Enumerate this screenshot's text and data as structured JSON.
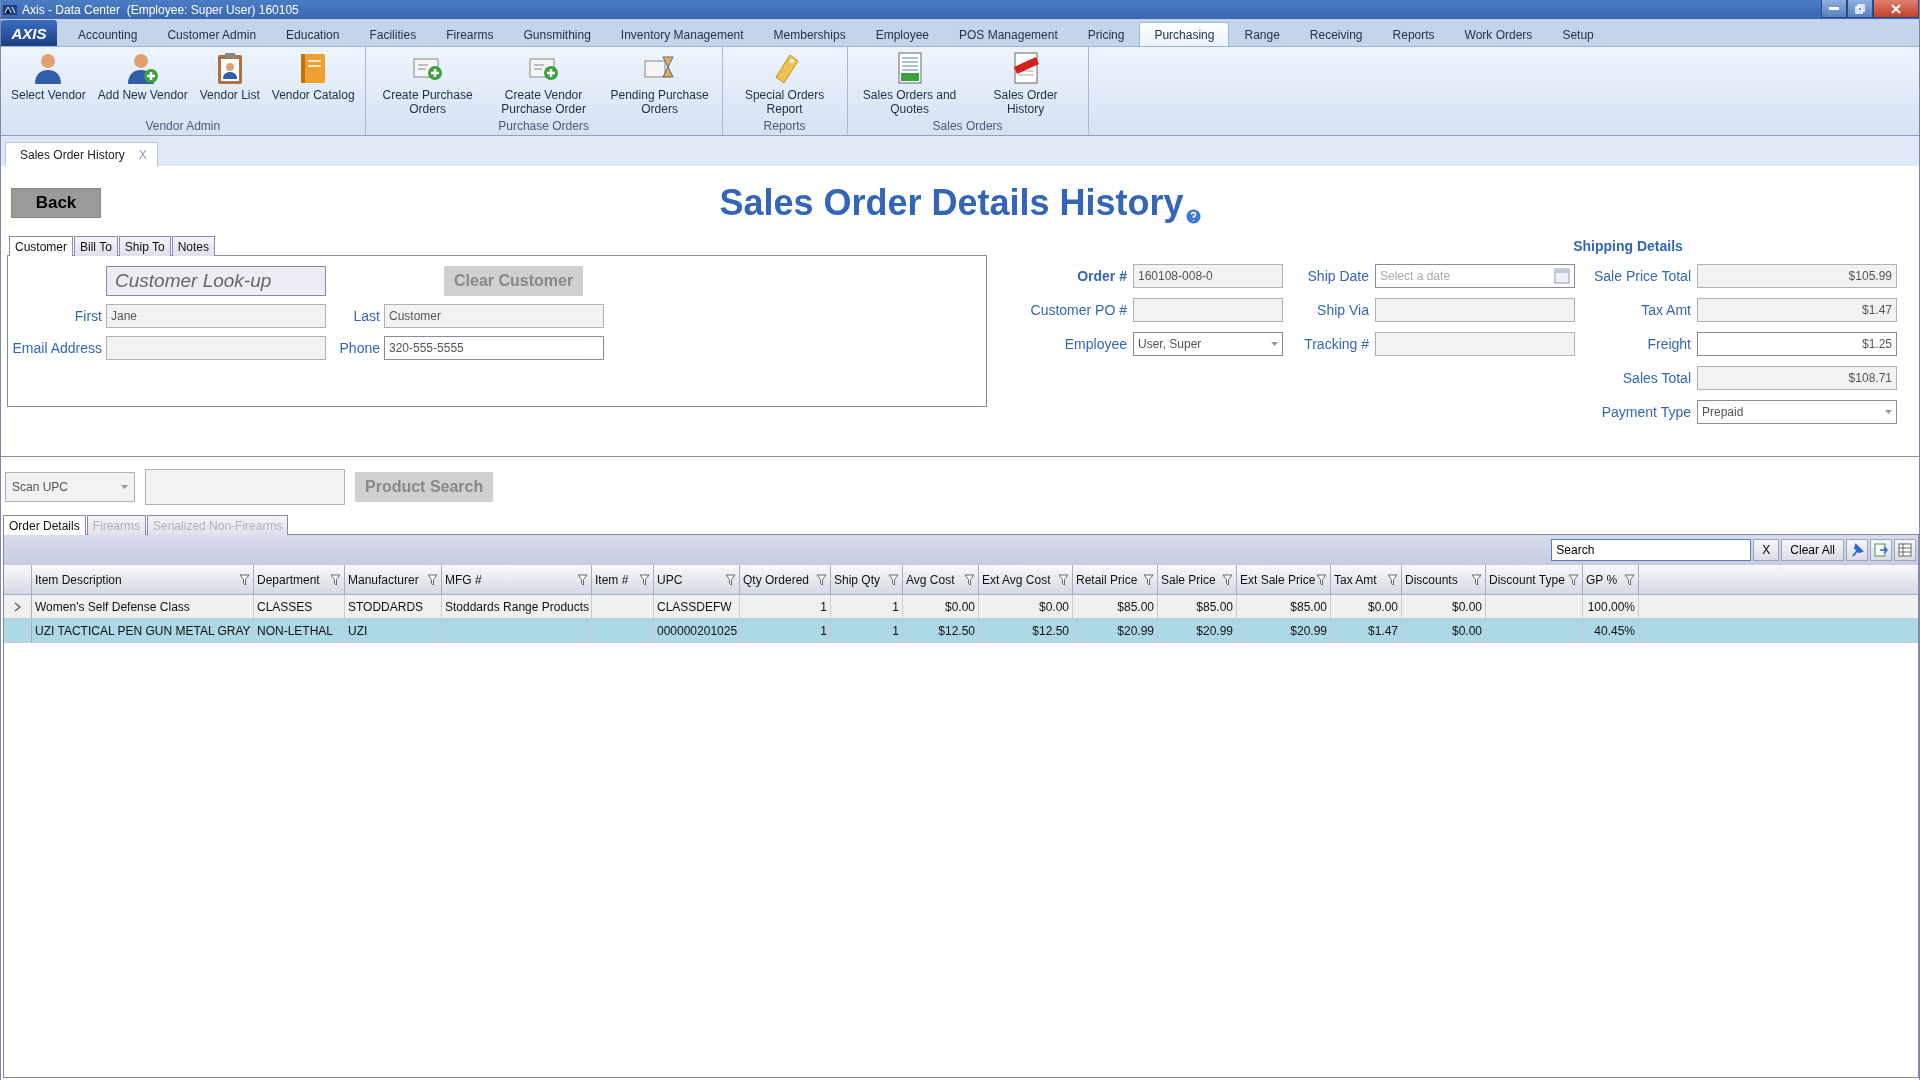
{
  "window": {
    "title": "Axis - Data Center  (Employee: Super User) 160105"
  },
  "app_button": {
    "label": "AXIS"
  },
  "menu_tabs": [
    {
      "label": "Accounting",
      "selected": false
    },
    {
      "label": "Customer Admin",
      "selected": false
    },
    {
      "label": "Education",
      "selected": false
    },
    {
      "label": "Facilities",
      "selected": false
    },
    {
      "label": "Firearms",
      "selected": false
    },
    {
      "label": "Gunsmithing",
      "selected": false
    },
    {
      "label": "Inventory Management",
      "selected": false
    },
    {
      "label": "Memberships",
      "selected": false
    },
    {
      "label": "Employee",
      "selected": false
    },
    {
      "label": "POS Management",
      "selected": false
    },
    {
      "label": "Pricing",
      "selected": false
    },
    {
      "label": "Purchasing",
      "selected": true
    },
    {
      "label": "Range",
      "selected": false
    },
    {
      "label": "Receiving",
      "selected": false
    },
    {
      "label": "Reports",
      "selected": false
    },
    {
      "label": "Work Orders",
      "selected": false
    },
    {
      "label": "Setup",
      "selected": false
    }
  ],
  "ribbon_groups": [
    {
      "label": "Vendor Admin",
      "buttons": [
        {
          "kind": "person",
          "label": "Select Vendor"
        },
        {
          "kind": "person-add",
          "label": "Add New Vendor"
        },
        {
          "kind": "clipboard",
          "label": "Vendor List"
        },
        {
          "kind": "book",
          "label": "Vendor Catalog"
        }
      ]
    },
    {
      "label": "Purchase Orders",
      "buttons": [
        {
          "kind": "po-add",
          "label": "Create Purchase Orders"
        },
        {
          "kind": "po-add",
          "label": "Create Vendor Purchase Order"
        },
        {
          "kind": "po-pending",
          "label": "Pending Purchase Orders"
        }
      ]
    },
    {
      "label": "Reports",
      "buttons": [
        {
          "kind": "tag",
          "label": "Special Orders Report"
        }
      ]
    },
    {
      "label": "Sales Orders",
      "buttons": [
        {
          "kind": "sheet",
          "label": "Sales Orders and Quotes"
        },
        {
          "kind": "paid",
          "label": "Sales Order History"
        }
      ]
    }
  ],
  "document_tabs": [
    {
      "label": "Sales Order History",
      "close": "X"
    }
  ],
  "back_button": {
    "label": "Back"
  },
  "page_title": "Sales Order Details History",
  "customer_tabs": [
    {
      "label": "Customer",
      "selected": true
    },
    {
      "label": "Bill To",
      "selected": false
    },
    {
      "label": "Ship To",
      "selected": false
    },
    {
      "label": "Notes",
      "selected": false
    }
  ],
  "customer": {
    "lookup_button": "Customer Look-up",
    "clear_button": "Clear Customer",
    "fields": [
      {
        "label": "First",
        "value": "Jane",
        "disabled": true
      },
      {
        "label": "Last",
        "value": "Customer",
        "disabled": true
      },
      {
        "label": "Email Address",
        "disabled": true
      },
      {
        "label": "Phone",
        "value": "320-555-5555",
        "disabled": false
      }
    ]
  },
  "order": {
    "fields": [
      {
        "label": "Order #",
        "value": "160108-008-0",
        "kind": "text"
      },
      {
        "label": "Customer PO #",
        "kind": "text"
      },
      {
        "label": "Employee",
        "value": "User, Super",
        "kind": "dropdown"
      }
    ]
  },
  "shipping": {
    "title": "Shipping Details",
    "fields": [
      {
        "label": "Ship Date",
        "placeholder": "Select a date",
        "kind": "date"
      },
      {
        "label": "Ship Via",
        "kind": "text"
      },
      {
        "label": "Tracking #",
        "kind": "text"
      }
    ]
  },
  "totals": [
    {
      "label": "Sale Price Total",
      "value": "$105.99",
      "kind": "text",
      "disabled": true
    },
    {
      "label": "Tax Amt",
      "value": "$1.47",
      "kind": "text",
      "disabled": true
    },
    {
      "label": "Freight",
      "value": "$1.25",
      "kind": "text",
      "disabled": false
    },
    {
      "label": "Sales Total",
      "value": "$108.71",
      "kind": "text",
      "disabled": true
    },
    {
      "label": "Payment Type",
      "value": "Prepaid",
      "kind": "dropdown",
      "disabled": false
    }
  ],
  "scan": {
    "mode": "Scan UPC",
    "product_search": "Product Search"
  },
  "detail_tabs": [
    {
      "label": "Order Details",
      "selected": true
    },
    {
      "label": "Firearms",
      "selected": false
    },
    {
      "label": "Serialized Non-Firearms",
      "selected": false
    }
  ],
  "grid_toolbar": {
    "search": "Search",
    "clear": "X",
    "clear_all": "Clear All"
  },
  "table": {
    "columns": [
      {
        "label": "Item Description",
        "kind": "text"
      },
      {
        "label": "Department",
        "kind": "text"
      },
      {
        "label": "Manufacturer",
        "kind": "text"
      },
      {
        "label": "MFG #",
        "kind": "text"
      },
      {
        "label": "Item #",
        "kind": "text"
      },
      {
        "label": "UPC",
        "kind": "text"
      },
      {
        "label": "Qty Ordered",
        "kind": "number"
      },
      {
        "label": "Ship Qty",
        "kind": "number"
      },
      {
        "label": "Avg Cost",
        "kind": "number"
      },
      {
        "label": "Ext Avg Cost",
        "kind": "number"
      },
      {
        "label": "Retail Price",
        "kind": "number"
      },
      {
        "label": "Sale Price",
        "kind": "number"
      },
      {
        "label": "Ext Sale Price",
        "kind": "number"
      },
      {
        "label": "Tax Amt",
        "kind": "number"
      },
      {
        "label": "Discounts",
        "kind": "number"
      },
      {
        "label": "Discount Type",
        "kind": "text"
      },
      {
        "label": "GP %",
        "kind": "number"
      }
    ],
    "rows": [
      {
        "current": true,
        "selected": false,
        "cells": [
          "Women's Self Defense Class",
          "CLASSES",
          "STODDARDS",
          "Stoddards Range Products",
          "",
          "CLASSDEFW",
          "1",
          "1",
          "$0.00",
          "$0.00",
          "$85.00",
          "$85.00",
          "$85.00",
          "$0.00",
          "$0.00",
          "",
          "100.00%"
        ]
      },
      {
        "current": false,
        "selected": true,
        "cells": [
          "UZI TACTICAL PEN GUN METAL GRAY",
          "NON-LETHAL",
          "UZI",
          "",
          "",
          "000000201025",
          "1",
          "1",
          "$12.50",
          "$12.50",
          "$20.99",
          "$20.99",
          "$20.99",
          "$1.47",
          "$0.00",
          "",
          "40.45%"
        ]
      }
    ]
  }
}
